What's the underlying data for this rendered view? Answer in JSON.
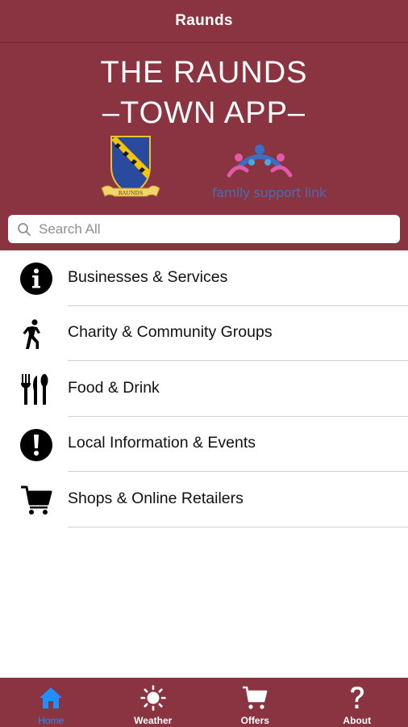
{
  "navbar": {
    "title": "Raunds"
  },
  "banner": {
    "line1": "THE RAUNDS",
    "line2": "–TOWN APP–",
    "crest_label": "RAUNDS",
    "partner_logo_text": "family support link"
  },
  "search": {
    "placeholder": "Search All",
    "value": ""
  },
  "list": {
    "items": [
      {
        "label": "Businesses & Services",
        "icon": "info-circle-icon"
      },
      {
        "label": "Charity & Community Groups",
        "icon": "walking-person-icon"
      },
      {
        "label": "Food & Drink",
        "icon": "cutlery-icon"
      },
      {
        "label": "Local Information & Events",
        "icon": "exclamation-circle-icon"
      },
      {
        "label": "Shops & Online Retailers",
        "icon": "shopping-cart-icon"
      }
    ]
  },
  "tabs": [
    {
      "label": "Home",
      "icon": "home-icon",
      "active": true
    },
    {
      "label": "Weather",
      "icon": "sun-icon",
      "active": false
    },
    {
      "label": "Offers",
      "icon": "cart-icon",
      "active": false
    },
    {
      "label": "About",
      "icon": "question-mark-icon",
      "active": false
    }
  ],
  "colors": {
    "brand": "#8a3441",
    "active_tab": "#1e90ff",
    "separator": "#cfcfd4"
  }
}
